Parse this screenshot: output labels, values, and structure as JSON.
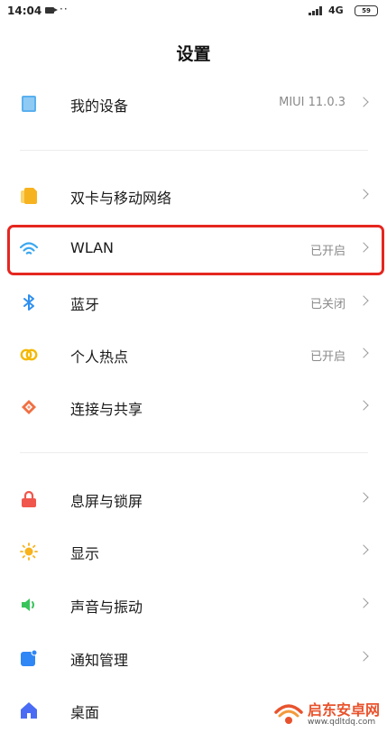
{
  "status_bar": {
    "time": "14:04",
    "dots": "··",
    "network": "4G",
    "battery": "59"
  },
  "header": {
    "title": "设置"
  },
  "settings": {
    "my_device": {
      "label": "我的设备",
      "value": "MIUI 11.0.3",
      "icon": "device-icon"
    },
    "dual_sim": {
      "label": "双卡与移动网络",
      "icon": "sim-card-icon"
    },
    "wlan": {
      "label": "WLAN",
      "value": "已开启",
      "icon": "wifi-icon"
    },
    "bluetooth": {
      "label": "蓝牙",
      "value": "已关闭",
      "icon": "bluetooth-icon"
    },
    "hotspot": {
      "label": "个人热点",
      "value": "已开启",
      "icon": "hotspot-icon"
    },
    "connection_sharing": {
      "label": "连接与共享",
      "icon": "share-icon"
    },
    "lock_screen": {
      "label": "息屏与锁屏",
      "icon": "lock-icon"
    },
    "display": {
      "label": "显示",
      "icon": "sun-icon"
    },
    "sound": {
      "label": "声音与振动",
      "icon": "speaker-icon"
    },
    "notifications": {
      "label": "通知管理",
      "icon": "notification-icon"
    },
    "desktop": {
      "label": "桌面",
      "icon": "home-icon"
    }
  },
  "watermark": {
    "name": "启东安卓网",
    "url": "www.qdltdq.com"
  },
  "colors": {
    "highlight_border": "#e5261f",
    "device_icon": "#5ab0ee",
    "sim_icon": "#f7b21f",
    "wifi_icon": "#3aa7f0",
    "bluetooth_icon": "#2e8ff0",
    "hotspot_icon": "#f5b800",
    "share_icon": "#f07043",
    "lock_icon": "#f0564b",
    "sun_icon": "#f8b21c",
    "speaker_icon": "#38c45a",
    "notification_icon": "#2f86f5",
    "home_icon": "#4a6cf5",
    "watermark_accent": "#e8532d"
  }
}
